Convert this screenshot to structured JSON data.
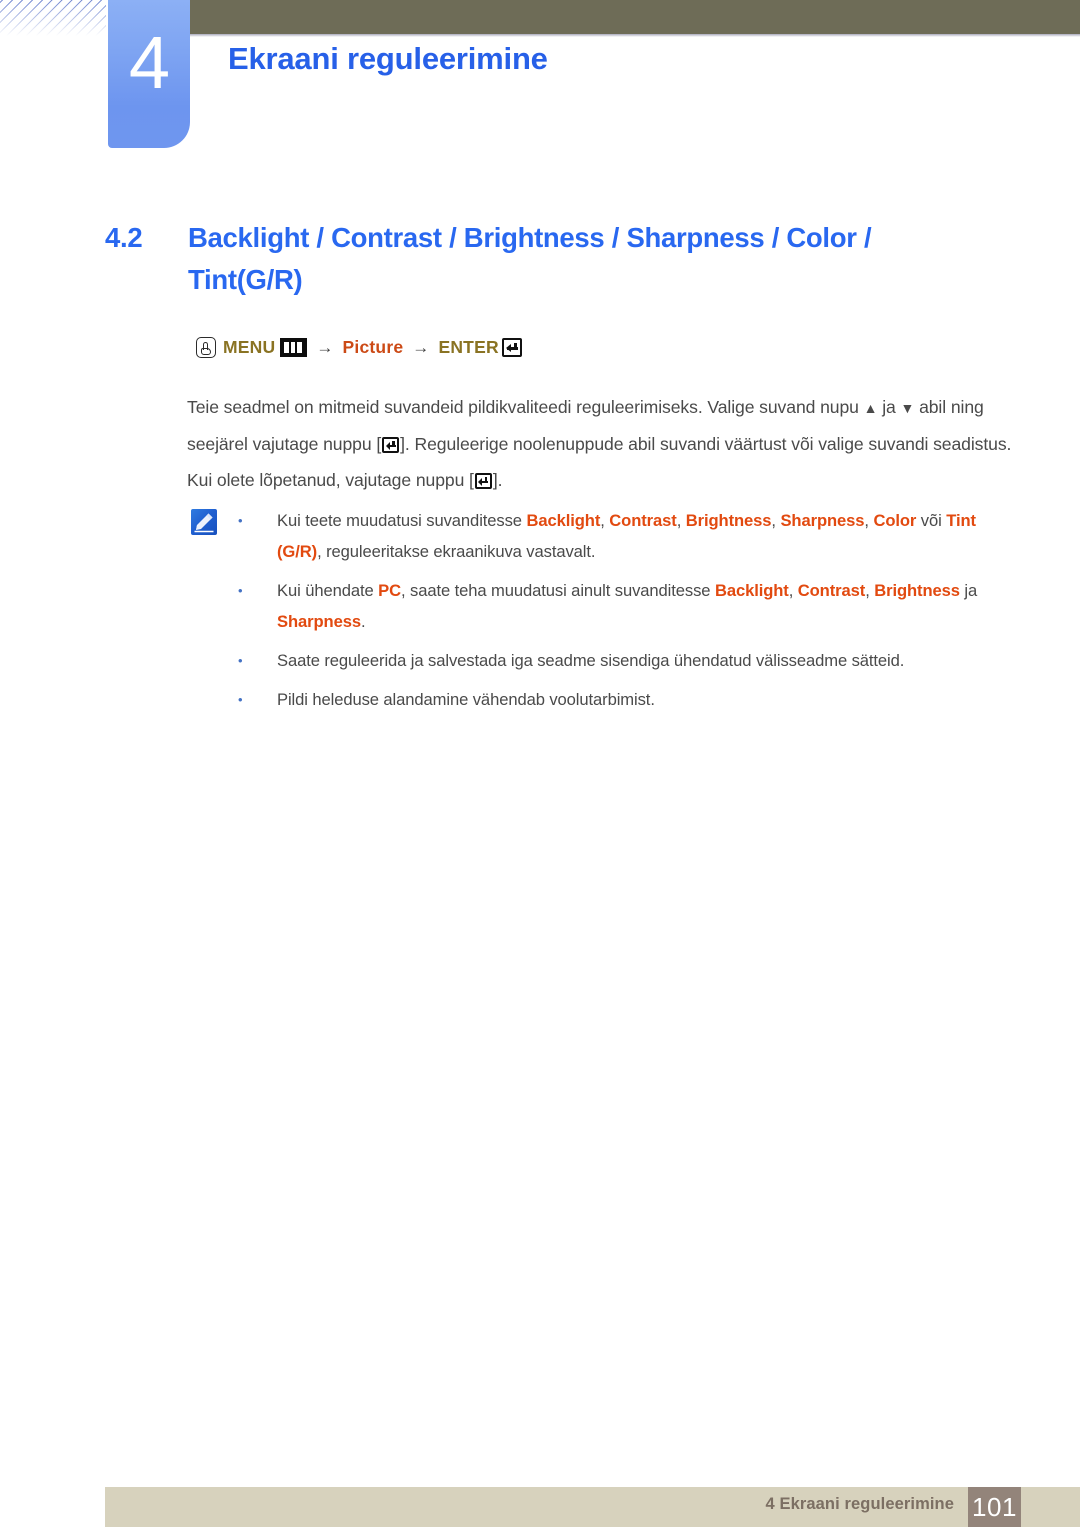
{
  "chapter": {
    "number": "4",
    "title": "Ekraani reguleerimine"
  },
  "section": {
    "number": "4.2",
    "title": "Backlight / Contrast / Brightness / Sharpness / Color / Tint(G/R)"
  },
  "menu_path": {
    "press_icon": "hand-press-icon",
    "menu_label": "MENU",
    "menu_icon": "menu-button-icon",
    "arrow1": "→",
    "picture_label": "Picture",
    "arrow2": "→",
    "enter_label": "ENTER",
    "enter_icon": "enter-key-icon"
  },
  "body": {
    "part1": "Teie seadmel on mitmeid suvandeid pildikvaliteedi reguleerimiseks. Valige suvand nupu",
    "up_arrow": "▲",
    "mid1": "ja",
    "down_arrow": "▼",
    "mid2": "abil ning seejärel vajutage nuppu [",
    "part2": "]. Reguleerige noolenuppude abil suvandi väärtust või valige suvandi seadistus. Kui olete lõpetanud, vajutage nuppu [",
    "part3": "]."
  },
  "note": {
    "icon": "note-pencil-icon",
    "items": [
      {
        "bullet": "•",
        "segments": [
          {
            "text": "Kui teete muudatusi suvanditesse ",
            "highlight": false
          },
          {
            "text": "Backlight",
            "highlight": true
          },
          {
            "text": ", ",
            "highlight": false
          },
          {
            "text": "Contrast",
            "highlight": true
          },
          {
            "text": ", ",
            "highlight": false
          },
          {
            "text": "Brightness",
            "highlight": true
          },
          {
            "text": ", ",
            "highlight": false
          },
          {
            "text": "Sharpness",
            "highlight": true
          },
          {
            "text": ", ",
            "highlight": false
          },
          {
            "text": "Color",
            "highlight": true
          },
          {
            "text": " või ",
            "highlight": false
          },
          {
            "text": "Tint (G/R)",
            "highlight": true
          },
          {
            "text": ", reguleeritakse ekraanikuva vastavalt.",
            "highlight": false
          }
        ]
      },
      {
        "bullet": "•",
        "segments": [
          {
            "text": "Kui ühendate ",
            "highlight": false
          },
          {
            "text": "PC",
            "highlight": true
          },
          {
            "text": ", saate teha muudatusi ainult suvanditesse ",
            "highlight": false
          },
          {
            "text": "Backlight",
            "highlight": true
          },
          {
            "text": ", ",
            "highlight": false
          },
          {
            "text": "Contrast",
            "highlight": true
          },
          {
            "text": ", ",
            "highlight": false
          },
          {
            "text": "Brightness",
            "highlight": true
          },
          {
            "text": " ja ",
            "highlight": false
          },
          {
            "text": "Sharpness",
            "highlight": true
          },
          {
            "text": ".",
            "highlight": false
          }
        ]
      },
      {
        "bullet": "•",
        "segments": [
          {
            "text": "Saate reguleerida ja salvestada iga seadme sisendiga ühendatud välisseadme sätteid.",
            "highlight": false
          }
        ]
      },
      {
        "bullet": "•",
        "segments": [
          {
            "text": "Pildi heleduse alandamine vähendab voolutarbimist.",
            "highlight": false
          }
        ]
      }
    ]
  },
  "footer": {
    "label": "4 Ekraani reguleerimine",
    "page": "101"
  },
  "colors": {
    "header_band": "#6e6c57",
    "chapter_blue": "#7ea4f2",
    "title_blue": "#2760e8",
    "heading_blue": "#2968f0",
    "menu_dark": "#8a7323",
    "menu_orange": "#cc4a16",
    "highlight_orange": "#e24a10",
    "body_gray": "#4a4a4a",
    "footer_bar": "#d7d2bd",
    "footer_page_box": "#93847a"
  }
}
